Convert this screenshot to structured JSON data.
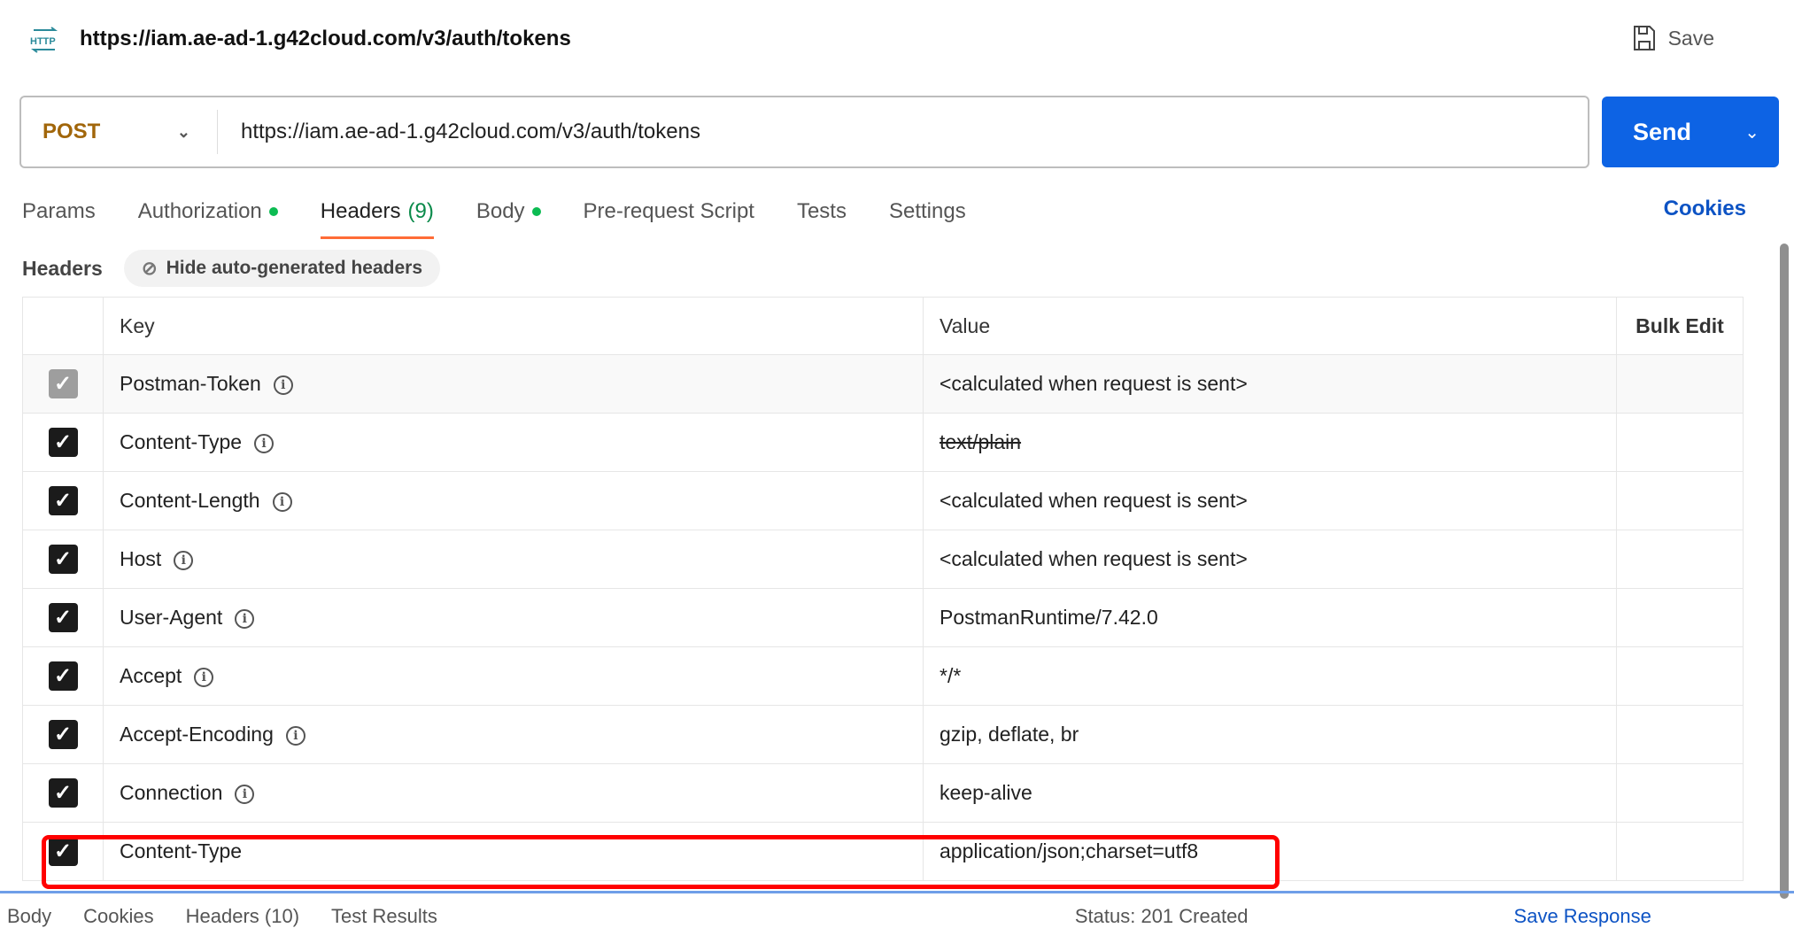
{
  "header": {
    "title": "https://iam.ae-ad-1.g42cloud.com/v3/auth/tokens",
    "icon": "http-icon",
    "save_label": "Save"
  },
  "request": {
    "method": "POST",
    "url": "https://iam.ae-ad-1.g42cloud.com/v3/auth/tokens",
    "send_label": "Send"
  },
  "tabs": [
    {
      "label": "Params"
    },
    {
      "label": "Authorization",
      "dot": true
    },
    {
      "label": "Headers",
      "count": "(9)",
      "active": true
    },
    {
      "label": "Body",
      "dot": true
    },
    {
      "label": "Pre-request Script"
    },
    {
      "label": "Tests"
    },
    {
      "label": "Settings"
    }
  ],
  "cookies_label": "Cookies",
  "headers_section": {
    "label": "Headers",
    "hide_button": "Hide auto-generated headers"
  },
  "table": {
    "columns": {
      "key": "Key",
      "value": "Value",
      "bulk_edit": "Bulk Edit"
    },
    "rows": [
      {
        "key": "Postman-Token",
        "value": "<calculated when request is sent>",
        "checked": true,
        "disabled": true
      },
      {
        "key": "Content-Type",
        "value": "text/plain",
        "checked": true,
        "overridden": true
      },
      {
        "key": "Content-Length",
        "value": "<calculated when request is sent>",
        "checked": true
      },
      {
        "key": "Host",
        "value": "<calculated when request is sent>",
        "checked": true
      },
      {
        "key": "User-Agent",
        "value": "PostmanRuntime/7.42.0",
        "checked": true
      },
      {
        "key": "Accept",
        "value": "*/*",
        "checked": true
      },
      {
        "key": "Accept-Encoding",
        "value": "gzip, deflate, br",
        "checked": true
      },
      {
        "key": "Connection",
        "value": "keep-alive",
        "checked": true
      },
      {
        "key": "Content-Type",
        "value": "application/json;charset=utf8",
        "checked": true,
        "highlighted": true
      }
    ]
  },
  "response_bar": {
    "tabs": [
      "Body",
      "Cookies",
      "Headers (10)",
      "Test Results"
    ],
    "status": "Status: 201 Created",
    "save_response": "Save Response"
  },
  "colors": {
    "accent": "#0d63e4",
    "method": "#a1660a",
    "tab_underline": "#ff6c37",
    "highlight": "#ff0000"
  }
}
